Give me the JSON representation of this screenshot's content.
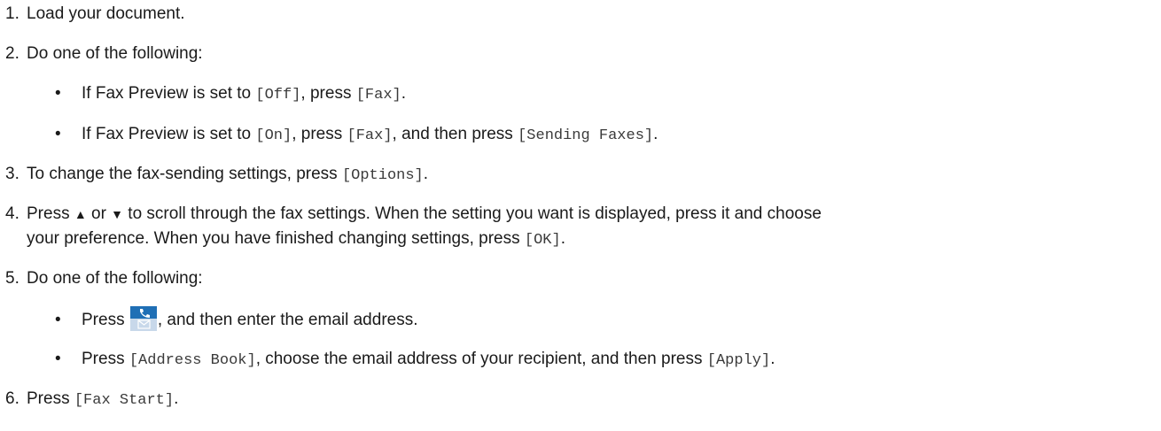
{
  "steps": [
    {
      "num": "1.",
      "text": "Load your document."
    },
    {
      "num": "2.",
      "text": "Do one of the following:",
      "bullets": [
        {
          "dot": "•",
          "a": "If Fax Preview is set to ",
          "b": "[Off]",
          "c": ", press ",
          "d": "[Fax]",
          "e": "."
        },
        {
          "dot": "•",
          "a": "If Fax Preview is set to ",
          "b": "[On]",
          "c": ", press ",
          "d": "[Fax]",
          "e": ", and then press ",
          "f": "[Sending Faxes]",
          "g": "."
        }
      ]
    },
    {
      "num": "3.",
      "a": "To change the fax-sending settings, press ",
      "b": "[Options]",
      "c": "."
    },
    {
      "num": "4.",
      "a": "Press ",
      "up": "▲",
      "b": " or ",
      "down": "▼",
      "c": " to scroll through the fax settings. When the setting you want is displayed, press it and choose",
      "d": "your preference. When you have finished changing settings, press ",
      "e": "[OK]",
      "f": "."
    },
    {
      "num": "5.",
      "text": "Do one of the following:",
      "bullets": [
        {
          "dot": "•",
          "a": "Press ",
          "icon": "fax-email-icon",
          "b": ", and then enter the email address."
        },
        {
          "dot": "•",
          "a": "Press ",
          "b": "[Address Book]",
          "c": ", choose the email address of your recipient, and then press ",
          "d": "[Apply]",
          "e": "."
        }
      ]
    },
    {
      "num": "6.",
      "a": "Press ",
      "b": "[Fax Start]",
      "c": "."
    }
  ],
  "colors": {
    "text": "#1a1a1a",
    "mono": "#3a3a3a",
    "icon_top": "#1f6fb5",
    "icon_bottom": "#c8d8ea"
  }
}
